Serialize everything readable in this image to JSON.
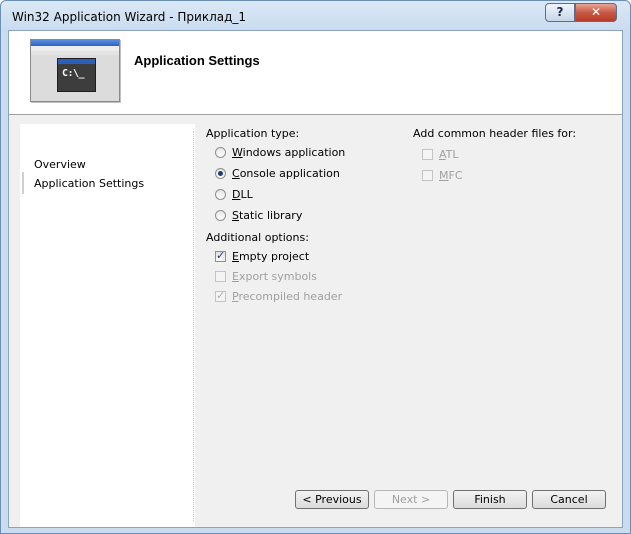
{
  "window": {
    "title": "Win32 Application Wizard - Приклад_1",
    "help_glyph": "?",
    "close_glyph": "✕"
  },
  "header": {
    "title": "Application Settings",
    "console_glyph": "C:\\_"
  },
  "sidebar": {
    "items": [
      {
        "label": "Overview"
      },
      {
        "label": "Application Settings",
        "active": true
      }
    ]
  },
  "application_type": {
    "label": "Application type:",
    "options": [
      {
        "label_rest": "indows application",
        "mnemonic": "W",
        "selected": false
      },
      {
        "label_rest": "onsole application",
        "mnemonic": "C",
        "selected": true
      },
      {
        "label_rest": "LL",
        "mnemonic": "D",
        "selected": false
      },
      {
        "label_rest": "tatic library",
        "mnemonic": "S",
        "selected": false
      }
    ]
  },
  "additional_options": {
    "label": "Additional options:",
    "options": [
      {
        "label_rest": "mpty project",
        "mnemonic": "E",
        "checked": true,
        "enabled": true
      },
      {
        "label_rest": "xport symbols",
        "mnemonic": "E",
        "checked": false,
        "enabled": false
      },
      {
        "label_rest": "recompiled header",
        "mnemonic": "P",
        "checked": true,
        "enabled": false
      }
    ]
  },
  "header_files": {
    "label": "Add common header files for:",
    "options": [
      {
        "label_rest": "TL",
        "mnemonic": "A",
        "checked": false,
        "enabled": false
      },
      {
        "label_rest": "FC",
        "mnemonic": "M",
        "checked": false,
        "enabled": false
      }
    ]
  },
  "buttons": {
    "previous": "< Previous",
    "next": "Next >",
    "finish": "Finish",
    "cancel": "Cancel"
  }
}
